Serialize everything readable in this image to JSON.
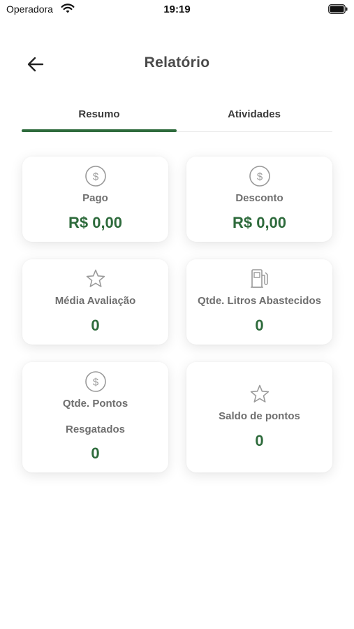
{
  "status_bar": {
    "carrier": "Operadora",
    "time": "19:19"
  },
  "header": {
    "title": "Relatório"
  },
  "tabs": [
    {
      "label": "Resumo",
      "active": true
    },
    {
      "label": "Atividades",
      "active": false
    }
  ],
  "cards": [
    {
      "icon": "dollar-circle-icon",
      "label": "Pago",
      "value": "R$ 0,00"
    },
    {
      "icon": "dollar-circle-icon",
      "label": "Desconto",
      "value": "R$ 0,00"
    },
    {
      "icon": "star-icon",
      "label": "Média Avaliação",
      "value": "0"
    },
    {
      "icon": "fuel-pump-icon",
      "label": "Qtde. Litros Abastecidos",
      "value": "0"
    },
    {
      "icon": "dollar-circle-icon",
      "label_line1": "Qtde. Pontos",
      "label_line2": "Resgatados",
      "value": "0"
    },
    {
      "icon": "star-icon",
      "label": "Saldo de pontos",
      "value": "0"
    }
  ],
  "colors": {
    "accent": "#2e6b3c",
    "label": "#6f6f6f",
    "title": "#4a4a4a",
    "icon": "#9a9a9a"
  }
}
